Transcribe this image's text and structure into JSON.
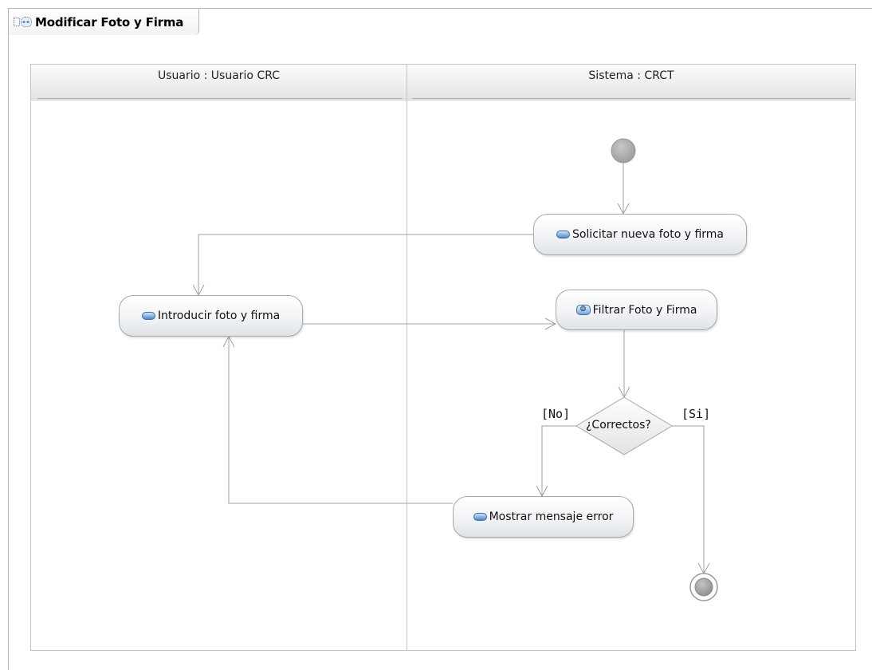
{
  "diagram": {
    "title": "Modificar Foto y Firma",
    "lanes": [
      {
        "label": "Usuario : Usuario CRC"
      },
      {
        "label": "Sistema : CRCT"
      }
    ],
    "actions": {
      "solicitar": "Solicitar nueva foto y firma",
      "introducir": "Introducir foto y firma",
      "filtrar": "Filtrar Foto y Firma",
      "mostrar": "Mostrar mensaje error"
    },
    "decision": {
      "label": "¿Correctos?",
      "guard_no": "[No]",
      "guard_si": "[Si]"
    },
    "icons": {
      "tab": "activity-diagram-icon",
      "action": "action-pill-icon",
      "activity": "call-behavior-icon",
      "initial": "initial-node-icon",
      "final": "activity-final-icon"
    }
  }
}
